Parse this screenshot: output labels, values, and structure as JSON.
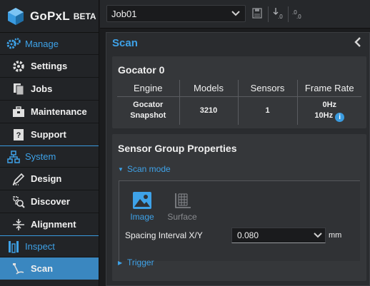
{
  "app": {
    "logo_text": "GoPxL",
    "badge": "BETA"
  },
  "sidebar": {
    "sections": [
      {
        "label": "Manage",
        "icon": "gears-icon",
        "items": [
          {
            "label": "Settings",
            "icon": "gear-icon"
          },
          {
            "label": "Jobs",
            "icon": "documents-icon"
          },
          {
            "label": "Maintenance",
            "icon": "toolbox-icon"
          },
          {
            "label": "Support",
            "icon": "help-book-icon"
          }
        ]
      },
      {
        "label": "System",
        "icon": "network-icon",
        "items": [
          {
            "label": "Design",
            "icon": "design-icon"
          },
          {
            "label": "Discover",
            "icon": "discover-icon"
          },
          {
            "label": "Alignment",
            "icon": "alignment-icon"
          }
        ]
      },
      {
        "label": "Inspect",
        "icon": "inspect-icon",
        "items": [
          {
            "label": "Scan",
            "icon": "scan-icon",
            "active": true
          }
        ]
      }
    ]
  },
  "toolbar": {
    "job_value": "Job01",
    "icons": [
      "save-icon",
      "load-number-icon",
      "save-number-icon"
    ]
  },
  "main": {
    "title": "Scan",
    "device": {
      "title": "Gocator 0",
      "columns": [
        "Engine",
        "Models",
        "Sensors",
        "Frame Rate"
      ],
      "row": {
        "engine_line1": "Gocator",
        "engine_line2": "Snapshot",
        "models": "3210",
        "sensors": "1",
        "frame_rate_line1": "0Hz",
        "frame_rate_line2": "10Hz"
      }
    },
    "group": {
      "title": "Sensor Group Properties",
      "scan_mode_label": "Scan mode",
      "modes": [
        {
          "label": "Image",
          "selected": true
        },
        {
          "label": "Surface",
          "selected": false
        }
      ],
      "spacing_label": "Spacing Interval X/Y",
      "spacing_value": "0.080",
      "spacing_unit": "mm",
      "trigger_label": "Trigger"
    }
  },
  "colors": {
    "accent": "#3ea2e8",
    "active_nav": "#3a87c0",
    "panel": "#2a2c2f",
    "card": "#35373a"
  }
}
